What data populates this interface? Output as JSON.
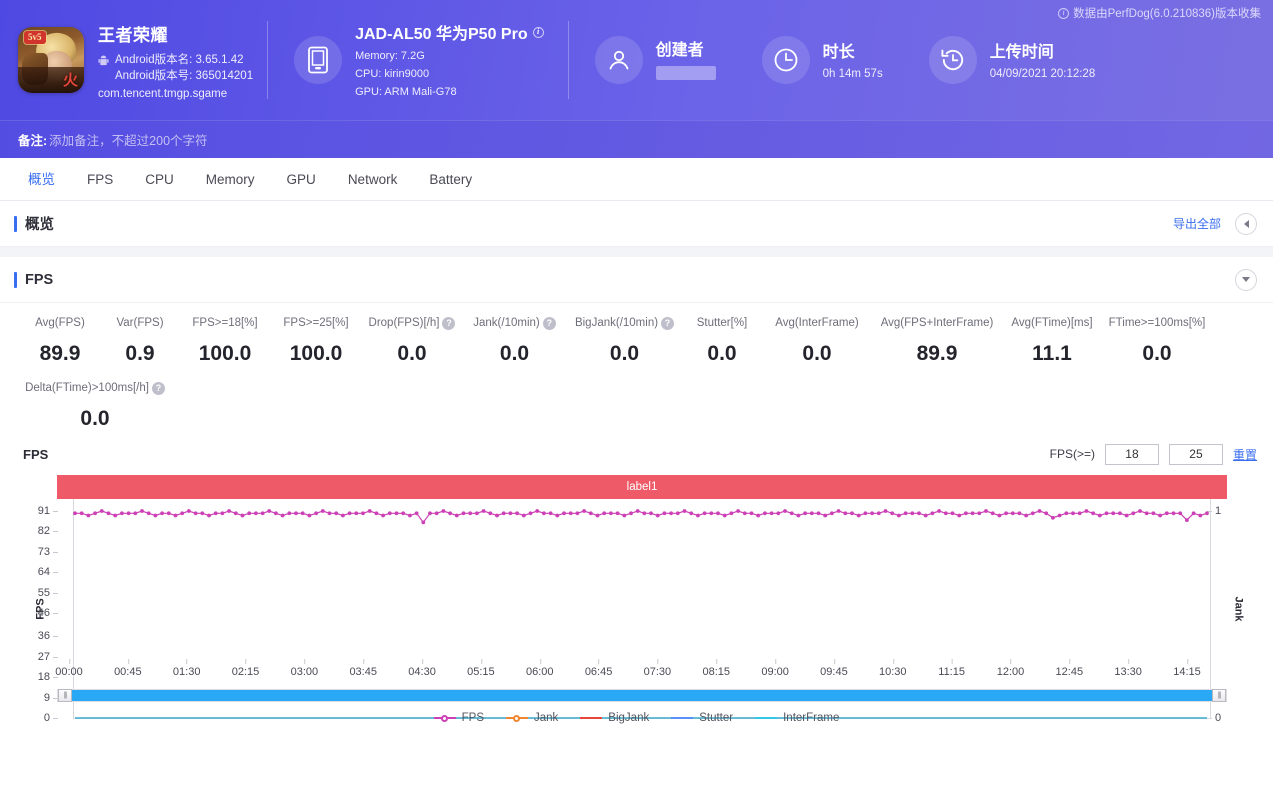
{
  "header": {
    "collect_note": "数据由PerfDog(6.0.210836)版本收集",
    "app": {
      "name": "王者荣耀",
      "version_name": "Android版本名: 3.65.1.42",
      "version_code": "Android版本号: 365014201",
      "package": "com.tencent.tmgp.sgame",
      "icon_badge": "5v5"
    },
    "device": {
      "title": "JAD-AL50 华为P50 Pro",
      "memory": "Memory: 7.2G",
      "cpu": "CPU: kirin9000",
      "gpu": "GPU: ARM Mali-G78"
    },
    "creator": {
      "title": "创建者",
      "value": ""
    },
    "duration": {
      "title": "时长",
      "value": "0h 14m 57s"
    },
    "upload": {
      "title": "上传时间",
      "value": "04/09/2021 20:12:28"
    }
  },
  "remark": {
    "label": "备注:",
    "placeholder": "添加备注，不超过200个字符"
  },
  "tabs": [
    {
      "label": "概览",
      "active": true
    },
    {
      "label": "FPS",
      "active": false
    },
    {
      "label": "CPU",
      "active": false
    },
    {
      "label": "Memory",
      "active": false
    },
    {
      "label": "GPU",
      "active": false
    },
    {
      "label": "Network",
      "active": false
    },
    {
      "label": "Battery",
      "active": false
    }
  ],
  "overview_panel": {
    "title": "概览",
    "export_label": "导出全部"
  },
  "fps_panel": {
    "title": "FPS"
  },
  "metrics_row1": [
    {
      "label": "Avg(FPS)",
      "value": "89.9",
      "help": false
    },
    {
      "label": "Var(FPS)",
      "value": "0.9",
      "help": false
    },
    {
      "label": "FPS>=18[%]",
      "value": "100.0",
      "help": false
    },
    {
      "label": "FPS>=25[%]",
      "value": "100.0",
      "help": false
    },
    {
      "label": "Drop(FPS)[/h]",
      "value": "0.0",
      "help": true
    },
    {
      "label": "Jank(/10min)",
      "value": "0.0",
      "help": true
    },
    {
      "label": "BigJank(/10min)",
      "value": "0.0",
      "help": true
    },
    {
      "label": "Stutter[%]",
      "value": "0.0",
      "help": false
    },
    {
      "label": "Avg(InterFrame)",
      "value": "0.0",
      "help": false
    },
    {
      "label": "Avg(FPS+InterFrame)",
      "value": "89.9",
      "help": false
    },
    {
      "label": "Avg(FTime)[ms]",
      "value": "11.1",
      "help": false
    },
    {
      "label": "FTime>=100ms[%]",
      "value": "0.0",
      "help": false
    }
  ],
  "metrics_row2": [
    {
      "label": "Delta(FTime)>100ms[/h]",
      "value": "0.0",
      "help": true
    }
  ],
  "chart_controls": {
    "chart_title": "FPS",
    "fps_label": "FPS(>=)",
    "threshold_low": "18",
    "threshold_high": "25",
    "reset_label": "重置"
  },
  "chart_data": {
    "type": "line",
    "title": "FPS",
    "band_label": "label1",
    "band_color": "#ee5a68",
    "xlabel": "",
    "ylabel": "FPS",
    "y2label": "Jank",
    "ylim": [
      0,
      91
    ],
    "y2lim": [
      0,
      1
    ],
    "yticks": [
      0,
      9,
      18,
      27,
      36,
      46,
      55,
      64,
      73,
      82,
      91
    ],
    "y2ticks": [
      0,
      1
    ],
    "xticks": [
      "00:00",
      "00:45",
      "01:30",
      "02:15",
      "03:00",
      "03:45",
      "04:30",
      "05:15",
      "06:00",
      "06:45",
      "07:30",
      "08:15",
      "09:00",
      "09:45",
      "10:30",
      "11:15",
      "12:00",
      "12:45",
      "13:30",
      "14:15"
    ],
    "grid": false,
    "legend_position": "bottom",
    "series": [
      {
        "name": "FPS",
        "color": "#cc3fb5",
        "marker": "circle",
        "mean": 89.9,
        "min": 82,
        "max": 91,
        "values": [
          90,
          90,
          89,
          90,
          91,
          90,
          89,
          90,
          90,
          90,
          91,
          90,
          89,
          90,
          90,
          89,
          90,
          91,
          90,
          90,
          89,
          90,
          90,
          91,
          90,
          89,
          90,
          90,
          90,
          91,
          90,
          89,
          90,
          90,
          90,
          89,
          90,
          91,
          90,
          90,
          89,
          90,
          90,
          90,
          91,
          90,
          89,
          90,
          90,
          90,
          89,
          90,
          86,
          90,
          90,
          91,
          90,
          89,
          90,
          90,
          90,
          91,
          90,
          89,
          90,
          90,
          90,
          89,
          90,
          91,
          90,
          90,
          89,
          90,
          90,
          90,
          91,
          90,
          89,
          90,
          90,
          90,
          89,
          90,
          91,
          90,
          90,
          89,
          90,
          90,
          90,
          91,
          90,
          89,
          90,
          90,
          90,
          89,
          90,
          91,
          90,
          90,
          89,
          90,
          90,
          90,
          91,
          90,
          89,
          90,
          90,
          90,
          89,
          90,
          91,
          90,
          90,
          89,
          90,
          90,
          90,
          91,
          90,
          89,
          90,
          90,
          90,
          89,
          90,
          91,
          90,
          90,
          89,
          90,
          90,
          90,
          91,
          90,
          89,
          90,
          90,
          90,
          89,
          90,
          91,
          90,
          88,
          89,
          90,
          90,
          90,
          91,
          90,
          89,
          90,
          90,
          90,
          89,
          90,
          91,
          90,
          90,
          89,
          90,
          90,
          90,
          87,
          90,
          89,
          90
        ]
      },
      {
        "name": "Jank",
        "color": "#f2862f",
        "marker": "circle",
        "values_all_zero": true,
        "constant": 0
      },
      {
        "name": "BigJank",
        "color": "#e8453c",
        "marker": "line",
        "values_all_zero": true,
        "constant": 0
      },
      {
        "name": "Stutter",
        "color": "#5b8ff9",
        "marker": "line",
        "values_all_zero": true,
        "constant": 0
      },
      {
        "name": "InterFrame",
        "color": "#2fc8e8",
        "marker": "line",
        "values_all_zero": true,
        "constant": 0
      }
    ],
    "legend": [
      {
        "name": "FPS",
        "color": "#cc3fb5",
        "marker": "circle"
      },
      {
        "name": "Jank",
        "color": "#f2862f",
        "marker": "circle"
      },
      {
        "name": "BigJank",
        "color": "#e8453c",
        "marker": "line"
      },
      {
        "name": "Stutter",
        "color": "#5b8ff9",
        "marker": "line"
      },
      {
        "name": "InterFrame",
        "color": "#2fc8e8",
        "marker": "line"
      }
    ]
  },
  "colors": {
    "brand": "#5b57e0",
    "accent": "#3a6ef0",
    "band": "#ee5a68",
    "scrollbar": "#29a8f5"
  }
}
